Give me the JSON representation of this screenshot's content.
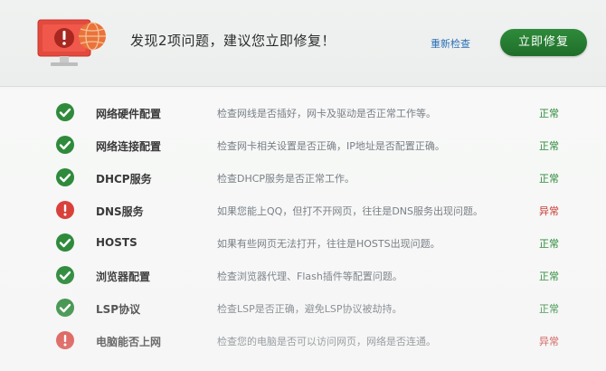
{
  "header": {
    "headline": "发现2项问题，建议您立即修复！",
    "rescan_label": "重新检查",
    "repair_label": "立即修复"
  },
  "colors": {
    "ok": "#2f8a3c",
    "error": "#d8413b",
    "link": "#2a6fb5",
    "button": "#2e8b3a"
  },
  "items": [
    {
      "name": "网络硬件配置",
      "desc": "检查网线是否插好，网卡及驱动是否正常工作等。",
      "status": "正常",
      "state": "ok"
    },
    {
      "name": "网络连接配置",
      "desc": "检查网卡相关设置是否正确，IP地址是否配置正确。",
      "status": "正常",
      "state": "ok"
    },
    {
      "name": "DHCP服务",
      "desc": "检查DHCP服务是否正常工作。",
      "status": "正常",
      "state": "ok"
    },
    {
      "name": "DNS服务",
      "desc": "如果您能上QQ，但打不开网页，往往是DNS服务出现问题。",
      "status": "异常",
      "state": "err"
    },
    {
      "name": "HOSTS",
      "desc": "如果有些网页无法打开，往往是HOSTS出现问题。",
      "status": "正常",
      "state": "ok"
    },
    {
      "name": "浏览器配置",
      "desc": "检查浏览器代理、Flash插件等配置问题。",
      "status": "正常",
      "state": "ok"
    },
    {
      "name": "LSP协议",
      "desc": "检查LSP是否正确，避免LSP协议被劫持。",
      "status": "正常",
      "state": "ok"
    },
    {
      "name": "电脑能否上网",
      "desc": "检查您的电脑是否可以访问网页，网络是否连通。",
      "status": "异常",
      "state": "err"
    }
  ]
}
